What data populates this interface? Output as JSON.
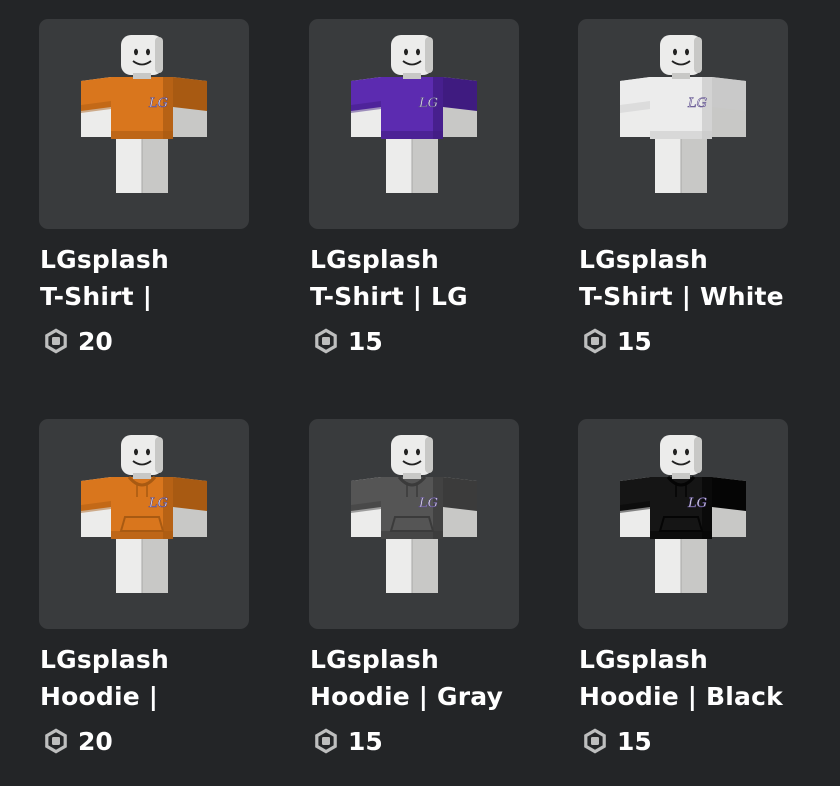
{
  "colors": {
    "background": "#232527",
    "thumb_background": "#393b3d",
    "text": "#ffffff",
    "robux_icon": "#bdbebe"
  },
  "items": [
    {
      "line1": "LGsplash",
      "line2": "T-Shirt |",
      "price": "20",
      "variant": "tshirt",
      "color": "#d9761d",
      "shade": "#a85a12",
      "icon": "robux-icon"
    },
    {
      "line1": "LGsplash",
      "line2": "T-Shirt | LG",
      "price": "15",
      "variant": "tshirt",
      "color": "#5c2bb0",
      "shade": "#3f1b80",
      "icon": "robux-icon"
    },
    {
      "line1": "LGsplash",
      "line2": "T-Shirt | White",
      "price": "15",
      "variant": "tshirt",
      "color": "#ececec",
      "shade": "#c9c9c9",
      "icon": "robux-icon"
    },
    {
      "line1": "LGsplash",
      "line2": "Hoodie |",
      "price": "20",
      "variant": "hoodie",
      "color": "#d9761d",
      "shade": "#a85a12",
      "icon": "robux-icon"
    },
    {
      "line1": "LGsplash",
      "line2": "Hoodie | Gray",
      "price": "15",
      "variant": "hoodie",
      "color": "#555555",
      "shade": "#3b3b3b",
      "icon": "robux-icon"
    },
    {
      "line1": "LGsplash",
      "line2": "Hoodie | Black",
      "price": "15",
      "variant": "hoodie",
      "color": "#151515",
      "shade": "#050505",
      "icon": "robux-icon"
    }
  ]
}
